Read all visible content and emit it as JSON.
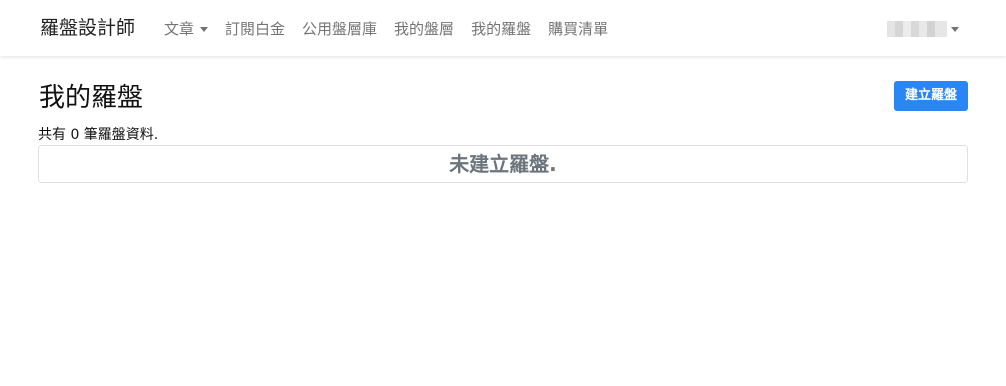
{
  "navbar": {
    "brand": "羅盤設計師",
    "items": [
      {
        "label": "文章",
        "dropdown": true
      },
      {
        "label": "訂閱白金"
      },
      {
        "label": "公用盤層庫"
      },
      {
        "label": "我的盤層"
      },
      {
        "label": "我的羅盤"
      },
      {
        "label": "購買清單"
      }
    ],
    "user_icon": "chevron-down-icon"
  },
  "main": {
    "title": "我的羅盤",
    "create_button": "建立羅盤",
    "count_text": "共有 0 筆羅盤資料.",
    "empty_message": "未建立羅盤."
  },
  "colors": {
    "accent": "#2b86f5",
    "muted": "#6c757d"
  }
}
